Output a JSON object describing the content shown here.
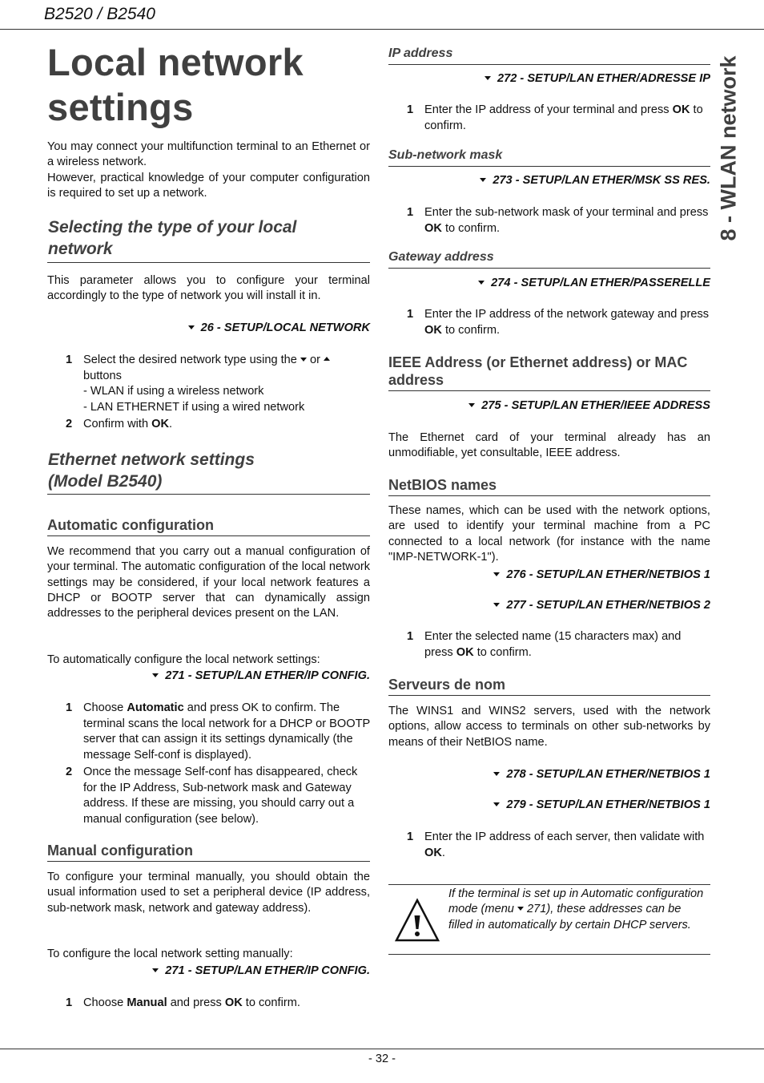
{
  "header": {
    "title": "B2520 / B2540"
  },
  "side_tab": {
    "label": "8 - WLAN network"
  },
  "footer": {
    "page_number": "- 32 -"
  },
  "left": {
    "title_line1": "Local network",
    "title_line2": "settings",
    "intro_1": "You may connect your multifunction terminal to an Ethernet or a wireless network.",
    "intro_2": "However, practical knowledge of your computer configuration is required to set up a network.",
    "select_type": {
      "heading_line1": "Selecting the type of your local",
      "heading_line2": "network",
      "body": "This parameter allows you to configure your terminal accordingly to the type of network you will install it in.",
      "menu": "26 - SETUP/LOCAL NETWORK",
      "steps": [
        {
          "num": "1",
          "pre": "Select the desired network type using the",
          "mid": "or",
          "post": "buttons",
          "sub1": "- WLAN if using a wireless network",
          "sub2": "- LAN ETHERNET if using a wired network"
        },
        {
          "num": "2",
          "pre": "Confirm with ",
          "bold": "OK",
          "post": "."
        }
      ]
    },
    "ethernet": {
      "heading_line1": "Ethernet network settings",
      "heading_line2": "(Model B2540)"
    },
    "auto_config": {
      "heading": "Automatic configuration",
      "body": "We recommend that you carry out a manual configuration of your terminal. The automatic configuration of the local network settings may be considered, if your local network features a DHCP or BOOTP server that can dynamically assign addresses to the peripheral devices present on the LAN.",
      "lead": "To automatically configure the local network settings:",
      "menu": "271 - SETUP/LAN ETHER/IP CONFIG.",
      "steps": [
        {
          "num": "1",
          "pre": "Choose ",
          "bold": "Automatic",
          "post": " and press OK to confirm. The terminal scans the local network for a DHCP or BOOTP server that can assign it its settings dynamically (the message Self-conf is displayed)."
        },
        {
          "num": "2",
          "text": "Once the message Self-conf has disappeared, check for the IP Address, Sub-network mask and Gateway address. If these are missing, you should carry out a manual configuration (see below)."
        }
      ]
    },
    "manual_config": {
      "heading": "Manual configuration",
      "body": "To configure your terminal manually, you should obtain the usual information used to set a peripheral device (IP address, sub-network mask, network and gateway address).",
      "lead": "To configure the local network setting manually:",
      "menu": "271 - SETUP/LAN ETHER/IP CONFIG.",
      "steps": [
        {
          "num": "1",
          "pre": "Choose ",
          "bold": "Manual",
          "mid": " and press ",
          "bold2": "OK",
          "post": " to confirm."
        }
      ]
    }
  },
  "right": {
    "ip_address": {
      "heading": "IP address",
      "menu": "272 - SETUP/LAN ETHER/ADRESSE IP",
      "step": {
        "num": "1",
        "pre": "Enter the IP address of your terminal and press ",
        "bold": "OK",
        "post": " to confirm."
      }
    },
    "subnet_mask": {
      "heading": "Sub-network mask",
      "menu": "273 - SETUP/LAN ETHER/MSK SS RES.",
      "step": {
        "num": "1",
        "pre": "Enter the sub-network mask of your terminal and press ",
        "bold": "OK",
        "post": " to confirm."
      }
    },
    "gateway": {
      "heading": "Gateway address",
      "menu": "274 - SETUP/LAN ETHER/PASSERELLE",
      "step": {
        "num": "1",
        "pre": "Enter the IP address of the network gateway and press ",
        "bold": "OK",
        "post": " to confirm."
      }
    },
    "ieee": {
      "heading_line1": "IEEE Address (or Ethernet address) or MAC",
      "heading_line2": "address",
      "menu": "275 - SETUP/LAN ETHER/IEEE ADDRESS",
      "body": "The Ethernet card of your terminal already has an unmodifiable, yet consultable, IEEE address."
    },
    "netbios": {
      "heading": "NetBIOS names",
      "body": "These names, which can be used with the network options, are used to identify your terminal machine from a PC connected to a local network (for instance with the name \"IMP-NETWORK-1\").",
      "menu1": "276 - SETUP/LAN ETHER/NETBIOS 1",
      "menu2": "277 - SETUP/LAN ETHER/NETBIOS 2",
      "step": {
        "num": "1",
        "pre": "Enter the selected name (15 characters max) and press ",
        "bold": "OK",
        "post": " to confirm."
      }
    },
    "servers": {
      "heading": "Serveurs de nom",
      "body": "The WINS1 and WINS2 servers, used with the network options, allow access to terminals on other sub-networks by means of their NetBIOS name.",
      "menu1": "278 - SETUP/LAN ETHER/NETBIOS 1",
      "menu2": "279 - SETUP/LAN ETHER/NETBIOS 1",
      "step": {
        "num": "1",
        "pre": "Enter the IP address of each server, then validate with ",
        "bold": "OK",
        "post": "."
      }
    },
    "note": {
      "pre": "If the terminal is set up in Automatic configuration mode (menu ",
      "post": " 271), these addresses can be filled in automatically by certain DHCP servers."
    }
  }
}
